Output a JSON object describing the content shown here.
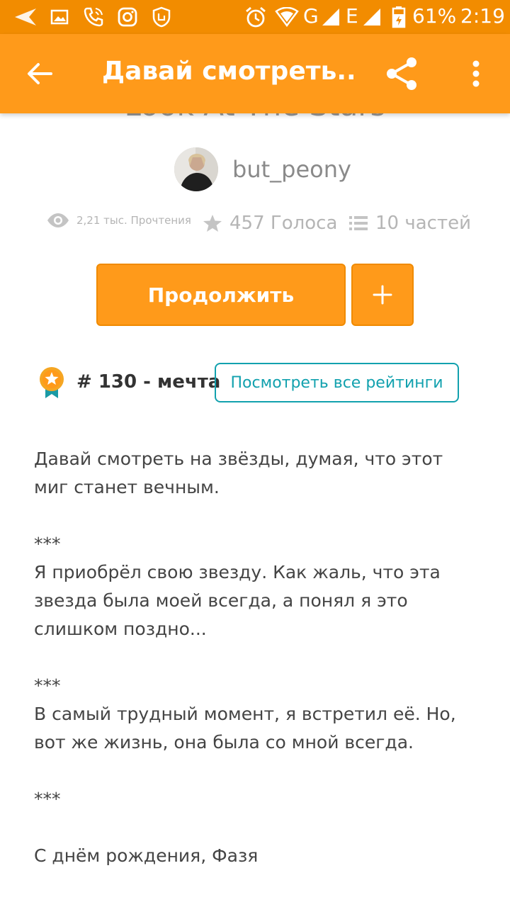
{
  "status_bar": {
    "battery": "61%",
    "time": "2:19",
    "network_g": "G",
    "network_e": "E"
  },
  "app_bar": {
    "title": "Давай смотреть..."
  },
  "story": {
    "title": "Look At The Stars",
    "author": "but_peony",
    "reads": "2,21 тыс. Прочтения",
    "votes": "457 Голоса",
    "parts": "10 частей"
  },
  "actions": {
    "continue_label": "Продолжить",
    "add_label": "+"
  },
  "ranking": {
    "text": "# 130 - мечта",
    "view_all_label": "Посмотреть все рейтинги"
  },
  "description": {
    "p1": "Давай смотреть на звёзды, думая, что этот миг станет вечным.",
    "sep1": "***",
    "p2": "Я приобрёл свою звезду. Как жаль, что эта звезда была моей всегда, а понял я это слишком поздно...",
    "sep2": "***",
    "p3": "В самый трудный момент, я встретил её. Но, вот же жизнь, она была со мной всегда.",
    "sep3": "***",
    "p4": "С днём рождения, Фазя"
  },
  "colors": {
    "status_bar": "#f28c00",
    "app_bar": "#ff9a1a",
    "accent_teal": "#12a1ae"
  }
}
